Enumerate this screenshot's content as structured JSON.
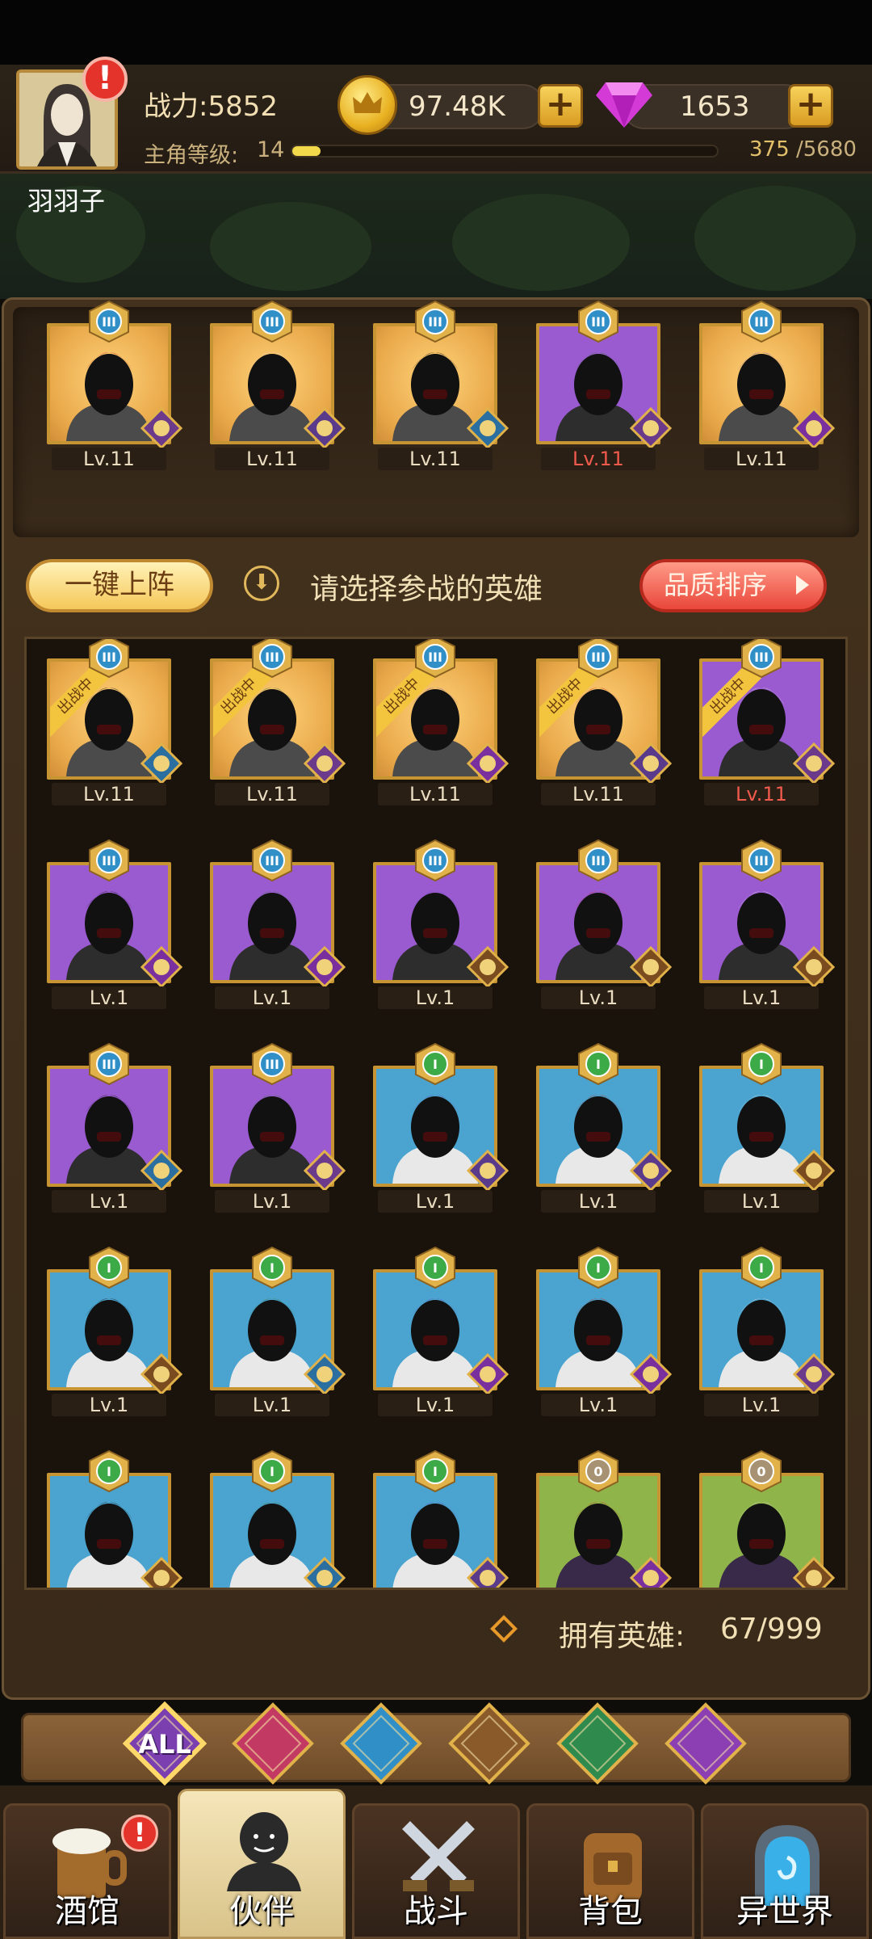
{
  "header": {
    "power_label": "战力:5852",
    "level_label": "主角等级:",
    "level_value": "14",
    "exp_current": "375",
    "exp_total": "/5680",
    "exp_fraction": 0.066,
    "gold": "97.48K",
    "gems": "1653",
    "plus": "+",
    "alert": "!",
    "username": "羽羽子"
  },
  "team": [
    {
      "tier": "III",
      "bg": "gold",
      "level": "Lv.11",
      "red": false,
      "faction": "helm-icon"
    },
    {
      "tier": "III",
      "bg": "gold",
      "level": "Lv.11",
      "red": false,
      "faction": "elf-icon"
    },
    {
      "tier": "III",
      "bg": "gold",
      "level": "Lv.11",
      "red": false,
      "faction": "fish-icon"
    },
    {
      "tier": "III",
      "bg": "purple",
      "level": "Lv.11",
      "red": true,
      "faction": "helm-icon"
    },
    {
      "tier": "III",
      "bg": "gold",
      "level": "Lv.11",
      "red": false,
      "faction": "demon-icon"
    }
  ],
  "controls": {
    "quick_deploy": "一键上阵",
    "prompt": "请选择参战的英雄",
    "sort": "品质排序"
  },
  "deployed_tag": "出战中",
  "heroes": [
    {
      "tier": "III",
      "bg": "gold",
      "level": "Lv.11",
      "red": false,
      "deployed": true,
      "faction": "fish-icon"
    },
    {
      "tier": "III",
      "bg": "gold",
      "level": "Lv.11",
      "red": false,
      "deployed": true,
      "faction": "helm-icon"
    },
    {
      "tier": "III",
      "bg": "gold",
      "level": "Lv.11",
      "red": false,
      "deployed": true,
      "faction": "demon-icon"
    },
    {
      "tier": "III",
      "bg": "gold",
      "level": "Lv.11",
      "red": false,
      "deployed": true,
      "faction": "elf-icon"
    },
    {
      "tier": "III",
      "bg": "purple",
      "level": "Lv.11",
      "red": true,
      "deployed": true,
      "faction": "helm-icon"
    },
    {
      "tier": "III",
      "bg": "purple",
      "level": "Lv.1",
      "red": false,
      "deployed": false,
      "faction": "demon-icon"
    },
    {
      "tier": "III",
      "bg": "purple",
      "level": "Lv.1",
      "red": false,
      "deployed": false,
      "faction": "demon-icon"
    },
    {
      "tier": "III",
      "bg": "purple",
      "level": "Lv.1",
      "red": false,
      "deployed": false,
      "faction": "lion-icon"
    },
    {
      "tier": "III",
      "bg": "purple",
      "level": "Lv.1",
      "red": false,
      "deployed": false,
      "faction": "lion-icon"
    },
    {
      "tier": "III",
      "bg": "purple",
      "level": "Lv.1",
      "red": false,
      "deployed": false,
      "faction": "lion-icon"
    },
    {
      "tier": "III",
      "bg": "purple",
      "level": "Lv.1",
      "red": false,
      "deployed": false,
      "faction": "fish-icon"
    },
    {
      "tier": "III",
      "bg": "purple",
      "level": "Lv.1",
      "red": false,
      "deployed": false,
      "faction": "helm-icon"
    },
    {
      "tier": "I",
      "bg": "blue",
      "level": "Lv.1",
      "red": false,
      "deployed": false,
      "faction": "elf-icon"
    },
    {
      "tier": "I",
      "bg": "blue",
      "level": "Lv.1",
      "red": false,
      "deployed": false,
      "faction": "elf-icon"
    },
    {
      "tier": "I",
      "bg": "blue",
      "level": "Lv.1",
      "red": false,
      "deployed": false,
      "faction": "lion-icon"
    },
    {
      "tier": "I",
      "bg": "blue",
      "level": "Lv.1",
      "red": false,
      "deployed": false,
      "faction": "lion-icon"
    },
    {
      "tier": "I",
      "bg": "blue",
      "level": "Lv.1",
      "red": false,
      "deployed": false,
      "faction": "fish-icon"
    },
    {
      "tier": "I",
      "bg": "blue",
      "level": "Lv.1",
      "red": false,
      "deployed": false,
      "faction": "demon-icon"
    },
    {
      "tier": "I",
      "bg": "blue",
      "level": "Lv.1",
      "red": false,
      "deployed": false,
      "faction": "demon-icon"
    },
    {
      "tier": "I",
      "bg": "blue",
      "level": "Lv.1",
      "red": false,
      "deployed": false,
      "faction": "helm-icon"
    },
    {
      "tier": "I",
      "bg": "blue",
      "level": "",
      "red": false,
      "deployed": false,
      "faction": "lion-icon"
    },
    {
      "tier": "I",
      "bg": "blue",
      "level": "",
      "red": false,
      "deployed": false,
      "faction": "fish-icon"
    },
    {
      "tier": "I",
      "bg": "blue",
      "level": "",
      "red": false,
      "deployed": false,
      "faction": "elf-icon"
    },
    {
      "tier": "0",
      "bg": "green",
      "level": "",
      "red": false,
      "deployed": false,
      "faction": "demon-icon"
    },
    {
      "tier": "0",
      "bg": "green",
      "level": "",
      "red": false,
      "deployed": false,
      "faction": "lion-icon"
    }
  ],
  "owned": {
    "label": "拥有英雄:",
    "value": "67/999"
  },
  "filters": [
    {
      "label": "ALL",
      "icon": "all-filter-icon",
      "color": "#7b3fb0"
    },
    {
      "label": "",
      "icon": "helm-filter-icon",
      "color": "#c23a63"
    },
    {
      "label": "",
      "icon": "fish-filter-icon",
      "color": "#2f8fc6"
    },
    {
      "label": "",
      "icon": "lion-filter-icon",
      "color": "#8a5a2b"
    },
    {
      "label": "",
      "icon": "elf-filter-icon",
      "color": "#2f8a4e"
    },
    {
      "label": "",
      "icon": "demon-filter-icon",
      "color": "#8c3fb3"
    }
  ],
  "nav": [
    {
      "label": "酒馆",
      "icon": "tavern-icon",
      "active": false
    },
    {
      "label": "伙伴",
      "icon": "partner-icon",
      "active": true
    },
    {
      "label": "战斗",
      "icon": "battle-icon",
      "active": false
    },
    {
      "label": "背包",
      "icon": "backpack-icon",
      "active": false
    },
    {
      "label": "异世界",
      "icon": "portal-icon",
      "active": false
    }
  ],
  "colors": {
    "gold_card": "#e9a94a",
    "purple_card": "#9a5bd0",
    "blue_card": "#4aa4cf",
    "green_card": "#8fb54a",
    "accent": "#f3c53f"
  }
}
